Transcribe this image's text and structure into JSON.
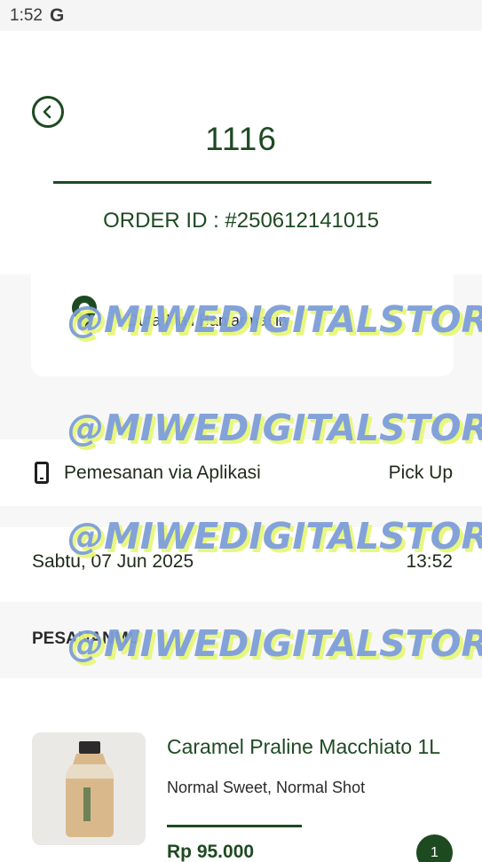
{
  "status_bar": {
    "time": "1:52",
    "g_icon": "G"
  },
  "header": {
    "back_icon": "chevron-left-icon",
    "order_number": "1116",
    "order_id": "ORDER ID : #250612141015"
  },
  "store": {
    "name": "Duta Mall Banjarmasin",
    "pin_icon": "location-pin-icon"
  },
  "order_channel": {
    "label": "Pemesanan via Aplikasi",
    "type": "Pick Up"
  },
  "order_datetime": {
    "date": "Sabtu, 07 Jun 2025",
    "time": "13:52"
  },
  "order_section": {
    "title": "PESANANMU"
  },
  "items": [
    {
      "name": "Caramel Praline Macchiato 1L",
      "options": "Normal Sweet, Normal Shot",
      "price": "Rp 95.000",
      "quantity": "1"
    }
  ],
  "watermark": "@MIWEDIGITALSTORE",
  "colors": {
    "brand_green": "#1e4a22",
    "background_gray": "#f7f7f7"
  }
}
